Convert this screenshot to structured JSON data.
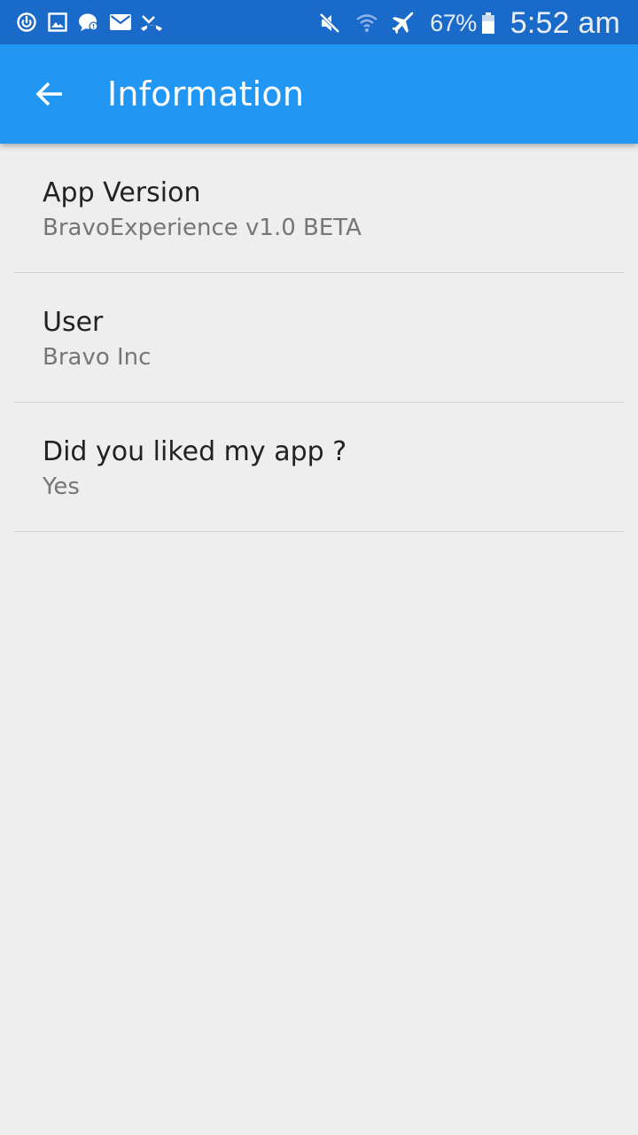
{
  "status_bar": {
    "left_icons": [
      "sync-icon",
      "image-icon",
      "chat-icon",
      "mail-icon",
      "missed-call-icon"
    ],
    "right_icons": [
      "mute-icon",
      "wifi-icon",
      "airplane-icon"
    ],
    "battery_percent": "67%",
    "battery_level": 0.67,
    "time": "5:52 am"
  },
  "app_bar": {
    "title": "Information",
    "back_icon": "arrow-back-icon",
    "background_color": "#2196f3"
  },
  "items": [
    {
      "title": "App Version",
      "subtitle": "BravoExperience v1.0 BETA"
    },
    {
      "title": "User",
      "subtitle": "Bravo Inc"
    },
    {
      "title": "Did you liked my app ?",
      "subtitle": "Yes"
    }
  ]
}
